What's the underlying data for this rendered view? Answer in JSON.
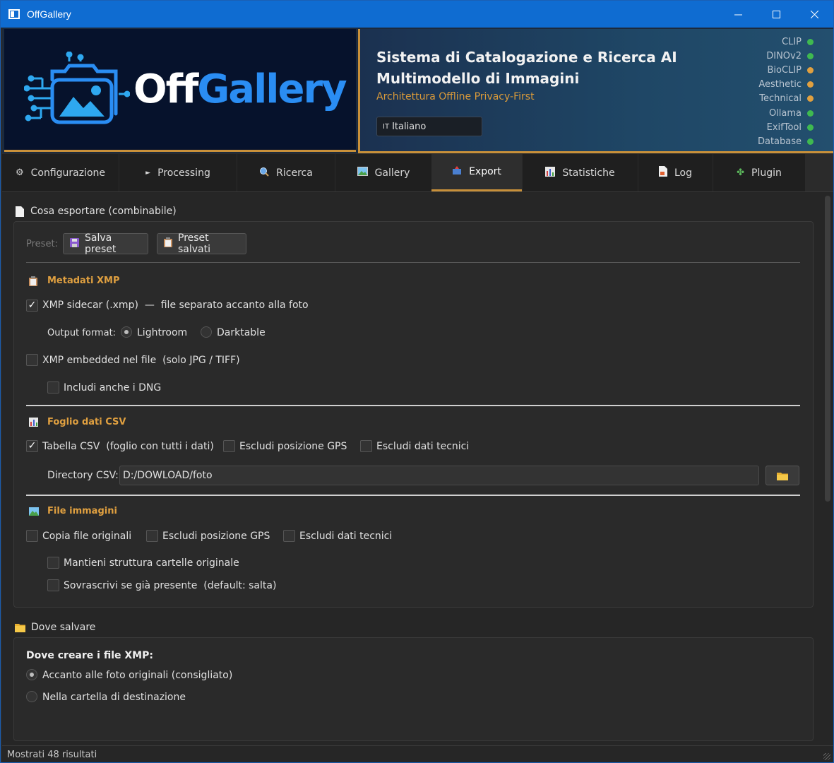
{
  "window": {
    "title": "OffGallery"
  },
  "header": {
    "logo_left": "Off",
    "logo_right": "Gallery",
    "headline_line1": "Sistema di Catalogazione e Ricerca AI",
    "headline_line2": "Multimodello di Immagini",
    "subtitle": "Architettura Offline Privacy-First",
    "language": {
      "flag": "IT",
      "value": "Italiano"
    },
    "status": [
      {
        "label": "CLIP",
        "color": "#3fb950"
      },
      {
        "label": "DINOv2",
        "color": "#3fb950"
      },
      {
        "label": "BioCLIP",
        "color": "#e0a040"
      },
      {
        "label": "Aesthetic",
        "color": "#e0a040"
      },
      {
        "label": "Technical",
        "color": "#e0a040"
      },
      {
        "label": "Ollama",
        "color": "#3fb950"
      },
      {
        "label": "ExifTool",
        "color": "#3fb950"
      },
      {
        "label": "Database",
        "color": "#3fb950"
      }
    ]
  },
  "tabs": [
    {
      "label": "Configurazione",
      "icon": "gear-icon"
    },
    {
      "label": "Processing",
      "icon": "play-icon"
    },
    {
      "label": "Ricerca",
      "icon": "search-icon"
    },
    {
      "label": "Gallery",
      "icon": "picture-icon"
    },
    {
      "label": "Export",
      "icon": "outbox-icon",
      "active": true
    },
    {
      "label": "Statistiche",
      "icon": "chart-icon"
    },
    {
      "label": "Log",
      "icon": "document-icon"
    },
    {
      "label": "Plugin",
      "icon": "puzzle-icon"
    }
  ],
  "export": {
    "section_title": "Cosa esportare (combinabile)",
    "preset_label": "Preset:",
    "save_preset": "Salva preset",
    "saved_presets": "Preset salvati",
    "xmp": {
      "title": "Metadati XMP",
      "sidecar_label": "XMP sidecar (.xmp)",
      "sidecar_sep": "—",
      "sidecar_desc": "file separato accanto alla foto",
      "sidecar_checked": true,
      "output_format_label": "Output format:",
      "format_options": [
        "Lightroom",
        "Darktable"
      ],
      "format_selected": "Lightroom",
      "embedded_label": "XMP embedded nel file",
      "embedded_desc": "(solo JPG / TIFF)",
      "embedded_checked": false,
      "dng_label": "Includi anche i DNG",
      "dng_checked": false
    },
    "csv": {
      "title": "Foglio dati CSV",
      "table_label": "Tabella CSV",
      "table_desc": "(foglio con tutti i dati)",
      "table_checked": true,
      "exclude_gps": "Escludi posizione GPS",
      "exclude_tech": "Escludi dati tecnici",
      "directory_label": "Directory CSV:",
      "directory_value": "D:/DOWLOAD/foto"
    },
    "images": {
      "title": "File immagini",
      "copy_label": "Copia file originali",
      "exclude_gps": "Escludi posizione GPS",
      "exclude_tech": "Escludi dati tecnici",
      "keep_structure": "Mantieni struttura cartelle originale",
      "overwrite_label": "Sovrascrivi se già presente",
      "overwrite_desc": "(default: salta)"
    }
  },
  "destination": {
    "section_title": "Dove salvare",
    "xmp_heading": "Dove creare i file XMP:",
    "options": [
      "Accanto alle foto originali  (consigliato)",
      "Nella cartella di destinazione"
    ],
    "selected": "Accanto alle foto originali  (consigliato)"
  },
  "statusbar": {
    "text": "Mostrati 48 risultati"
  },
  "colors": {
    "accent": "#c8903a",
    "titlebar": "#0f6cd1",
    "ok": "#3fb950",
    "warn": "#e0a040"
  }
}
